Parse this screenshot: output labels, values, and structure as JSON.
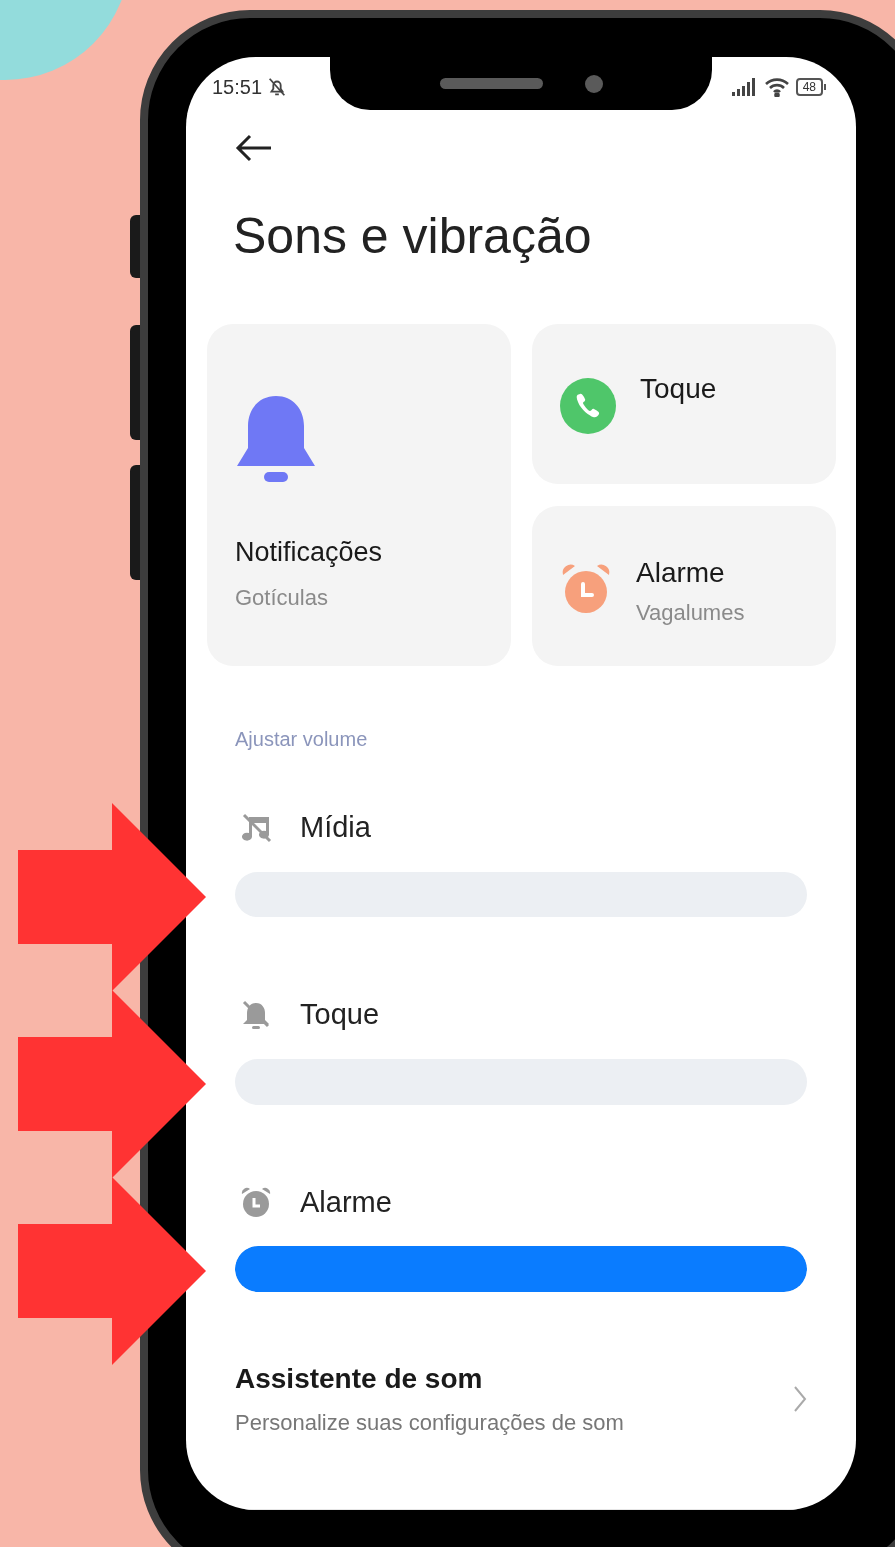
{
  "status_bar": {
    "time": "15:51",
    "battery": "48"
  },
  "title": "Sons e vibração",
  "sound_cards": [
    {
      "kind": "notification",
      "label": "Notificações",
      "value": "Gotículas"
    },
    {
      "kind": "ringtone",
      "label": "Toque"
    },
    {
      "kind": "alarm",
      "label": "Alarme",
      "value": "Vagalumes"
    }
  ],
  "section_label": "Ajustar volume",
  "volumes": [
    {
      "kind": "media",
      "label": "Mídia",
      "level": 0
    },
    {
      "kind": "ringtone",
      "label": "Toque",
      "level": 0
    },
    {
      "kind": "alarm",
      "label": "Alarme",
      "level": 1
    }
  ],
  "assistant": {
    "title": "Assistente de som",
    "subtitle": "Personalize suas configurações de som"
  }
}
